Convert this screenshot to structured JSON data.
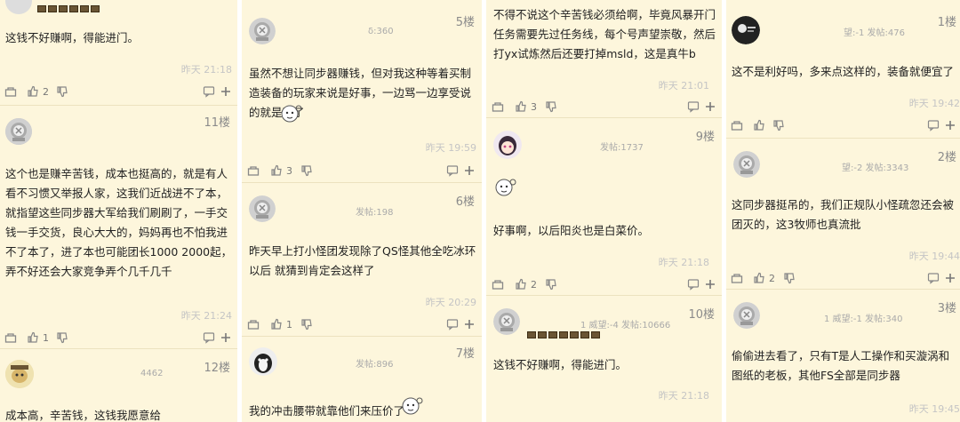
{
  "columns": [
    {
      "posts": [
        {
          "floor": "",
          "meta": "",
          "text": "这钱不好赚啊，得能进门。",
          "time": "昨天 21:18",
          "likes": "2"
        },
        {
          "floor": "11楼",
          "meta": "",
          "text": "这个也是赚辛苦钱，成本也挺高的，就是有人看不习惯又举报人家，这我们近战进不了本，就指望这些同步器大军给我们刷刷了，一手交钱一手交货，良心大大的，妈妈再也不怕我进不了本了，进了本也可能团长1000 2000起，弄不好还会大家竞争弄个几千几千",
          "time": "昨天 21:24",
          "likes": "1"
        },
        {
          "floor": "12楼",
          "meta": "4462",
          "text": "成本高，辛苦钱，这钱我愿意给",
          "time": "",
          "likes": ""
        }
      ]
    },
    {
      "posts": [
        {
          "floor": "5楼",
          "meta": "δ:360",
          "text": "虽然不想让同步器赚钱，但对我这种等着买制造装备的玩家来说是好事，一边骂一边享受说的就是我了",
          "time": "昨天 19:59",
          "likes": "3"
        },
        {
          "floor": "6楼",
          "meta": "发帖:198",
          "text": "昨天早上打小怪团发现除了QS怪其他全吃冰环以后 就猜到肯定会这样了",
          "time": "昨天 20:29",
          "likes": "1"
        },
        {
          "floor": "7楼",
          "meta": "发帖:896",
          "text": "我的冲击腰带就靠他们来压价了",
          "time": "",
          "likes": ""
        }
      ]
    },
    {
      "posts": [
        {
          "floor": "",
          "meta": "",
          "text": "不得不说这个辛苦钱必须给啊，毕竟风暴开门任务需要先过任务线，每个号声望崇敬，然后打yx试炼然后还要打掉msld，这是真牛b",
          "time": "昨天 21:01",
          "likes": "3"
        },
        {
          "floor": "9楼",
          "meta": "发帖:1737",
          "text": "好事啊，以后阳炎也是白菜价。",
          "time": "昨天 21:18",
          "likes": "2"
        },
        {
          "floor": "10楼",
          "meta": "1 威望:-4 发帖:10666",
          "text": "这钱不好赚啊，得能进门。",
          "time": "昨天 21:18",
          "likes": ""
        }
      ]
    },
    {
      "posts": [
        {
          "floor": "1楼",
          "meta": "望:-1 发帖:476",
          "text": "这不是利好吗，多来点这样的，装备就便宜了",
          "time": "昨天 19:42",
          "likes": ""
        },
        {
          "floor": "2楼",
          "meta": "望:-2 发帖:3343",
          "text": "这同步器挺吊的，我们正规队小怪疏忽还会被团灭的，这3牧师也真流批",
          "time": "昨天 19:44",
          "likes": "2"
        },
        {
          "floor": "3楼",
          "meta": "1 威望:-1 发帖:340",
          "text": "偷偷进去看了，只有T是人工操作和买漩涡和图纸的老板，其他FS全部是同步器",
          "time": "昨天 19:45",
          "likes": ""
        }
      ]
    }
  ],
  "icons": {
    "share": "share-icon",
    "like": "thumb-up-icon",
    "dislike": "thumb-down-icon",
    "comment": "comment-icon",
    "more": "plus-icon"
  },
  "colors": {
    "background": "#fdf6dc",
    "text": "#222222",
    "muted": "#aaaaaa"
  }
}
